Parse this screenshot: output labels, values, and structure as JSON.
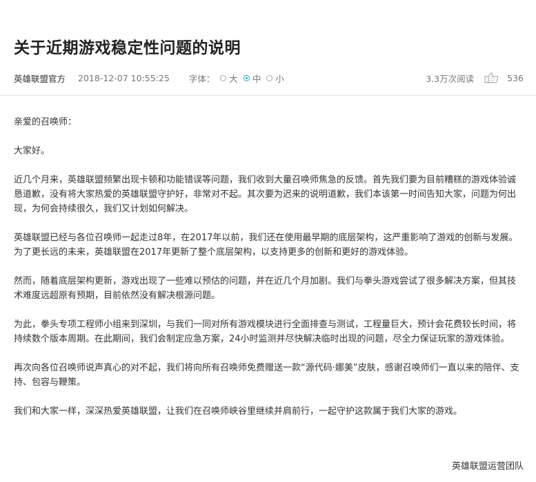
{
  "article": {
    "title": "关于近期游戏稳定性问题的说明",
    "author": "英雄联盟官方",
    "time": "2018-12-07 10:55:25",
    "font_size_label": "字体：",
    "font_options": [
      "大",
      "中",
      "小"
    ],
    "font_selected": "中",
    "reads": "3.3万次阅读",
    "likes": "536",
    "paragraphs": [
      "亲爱的召唤师：",
      "大家好。",
      "近几个月来，英雄联盟频繁出现卡顿和功能错误等问题，我们收到大量召唤师焦急的反馈。首先我们要为目前糟糕的游戏体验诚恳道歉，没有将大家热爱的英雄联盟守护好，非常对不起。其次要为迟来的说明道歉，我们本该第一时间告知大家，问题为何出现，为何会持续很久，我们又计划如何解决。",
      "英雄联盟已经与各位召唤师一起走过8年，在2017年以前，我们还在使用最早期的底层架构，这严重影响了游戏的创新与发展。为了更长远的未来，英雄联盟在2017年更新了整个底层架构，以支持更多的创新和更好的游戏体验。",
      "然而，随着底层架构更新，游戏出现了一些难以预估的问题，并在近几个月加剧。我们与拳头游戏尝试了很多解决方案，但其技术难度远超原有预期，目前依然没有解决根源问题。",
      "为此，拳头专项工程师小组来到深圳，与我们一同对所有游戏模块进行全面排查与测试，工程量巨大，预计会花费较长时间，将持续数个版本周期。在此期间，我们会制定应急方案，24小时监测并尽快解决临时出现的问题，尽全力保证玩家的游戏体验。",
      "再次向各位召唤师说声真心的对不起，我们将向所有召唤师免费赠送一款“源代码·娜美”皮肤，感谢召唤师们一直以来的陪伴、支持、包容与鞭策。",
      "我们和大家一样，深深热爱英雄联盟，让我们在召唤师峡谷里继续并肩前行，一起守护这款属于我们大家的游戏。"
    ],
    "signature": "英雄联盟运营团队"
  },
  "colors": {
    "accent": "#2aa8c8",
    "meta_text": "#777777",
    "body_text": "#333333"
  },
  "icons": {
    "like": "thumbs-up-icon"
  }
}
